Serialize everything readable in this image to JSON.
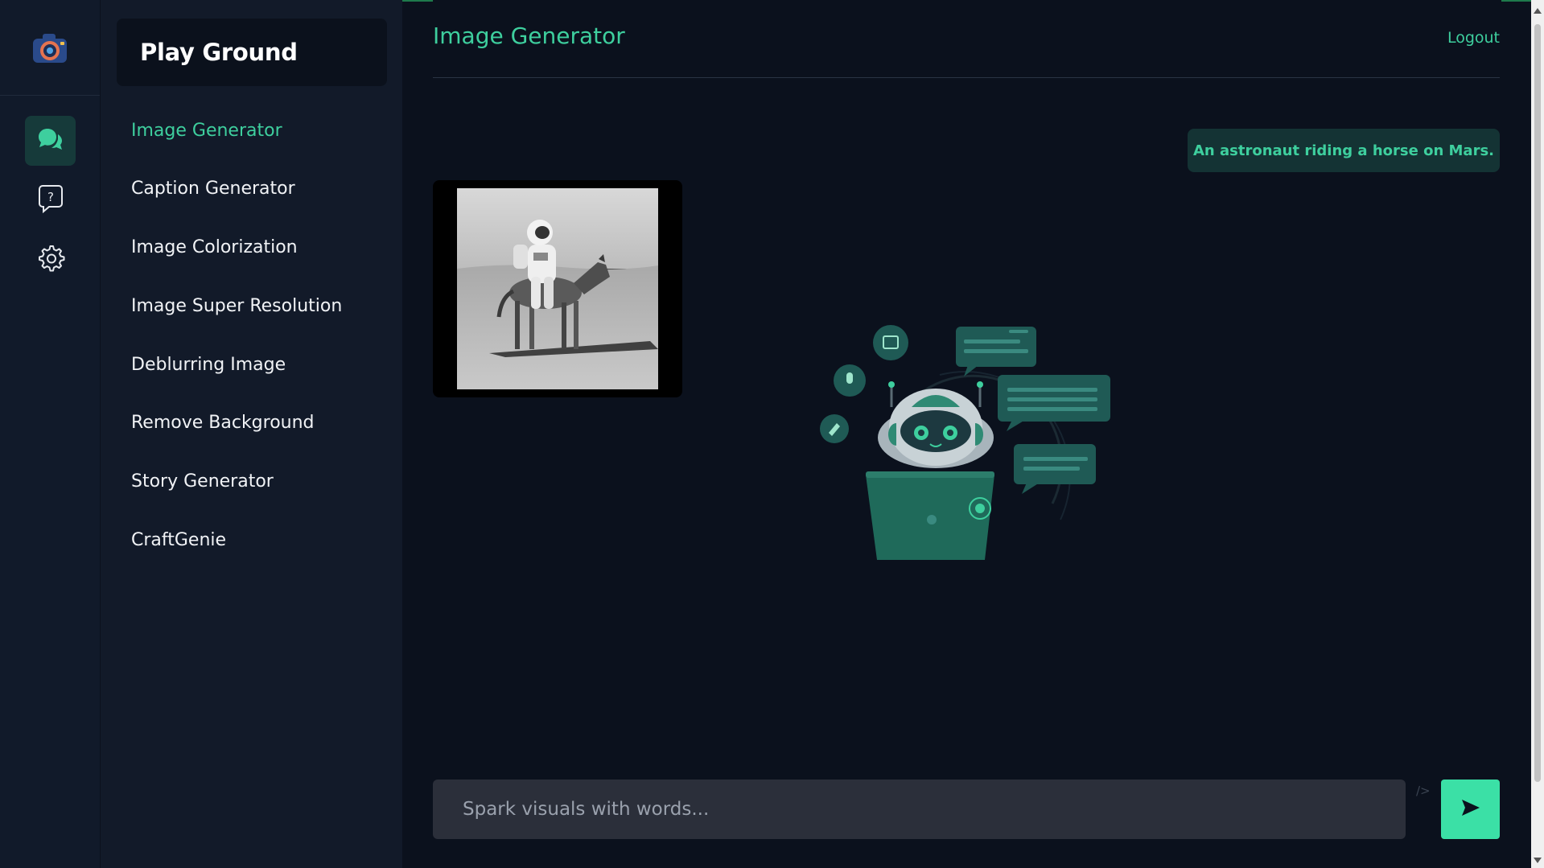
{
  "sidebar": {
    "title": "Play Ground",
    "items": [
      {
        "label": "Image Generator",
        "active": true
      },
      {
        "label": "Caption Generator"
      },
      {
        "label": "Image Colorization"
      },
      {
        "label": "Image Super Resolution"
      },
      {
        "label": "Deblurring Image"
      },
      {
        "label": "Remove Background"
      },
      {
        "label": "Story Generator"
      },
      {
        "label": "CraftGenie"
      }
    ]
  },
  "rail": {
    "icons": [
      "camera-logo-icon",
      "chat-bubbles-icon",
      "help-bubble-icon",
      "gear-icon"
    ]
  },
  "header": {
    "title": "Image Generator",
    "logout_label": "Logout"
  },
  "conversation": {
    "prompt": "An astronaut riding a horse on Mars."
  },
  "composer": {
    "placeholder": "Spark visuals with words...",
    "code_hint": "/>"
  },
  "colors": {
    "accent": "#3ecf9e",
    "send_button": "#3be0a6",
    "background": "#0b111d",
    "sidebar": "#121a29"
  }
}
